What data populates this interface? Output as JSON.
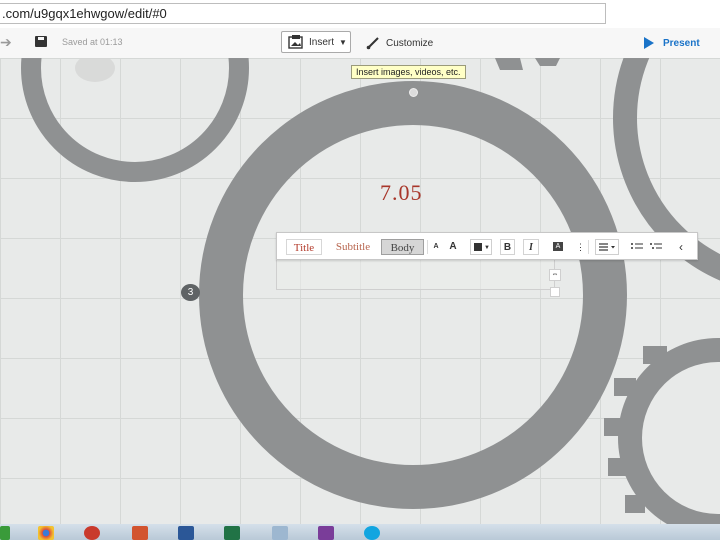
{
  "browser": {
    "url": ".com/u9gqx1ehwgow/edit/#0"
  },
  "toolbar": {
    "saved_label": "Saved at 01:13",
    "insert_label": "Insert",
    "customize_label": "Customize",
    "present_label": "Present",
    "icons": [
      "arrow-icon",
      "save-icon",
      "insert-icon",
      "chevron-down-icon",
      "brush-icon",
      "play-icon"
    ]
  },
  "tooltip": {
    "text": "Insert images, videos, etc."
  },
  "canvas": {
    "title": "7.05",
    "step_number": "3",
    "colors": {
      "title": "#a8362a",
      "gear": "#8f9192",
      "background": "#e8eae9"
    }
  },
  "format_bar": {
    "styles": [
      "Title",
      "Subtitle",
      "Body"
    ],
    "active_style": "Body",
    "font_small": "A",
    "font_large": "A",
    "bold": "B",
    "italic": "I",
    "highlight": "A",
    "more": "⋮",
    "collapse": "‹"
  },
  "taskbar": {
    "apps": [
      "windows-icon",
      "chrome-icon",
      "chrome-icon",
      "powerpoint-icon",
      "word-icon",
      "excel-icon",
      "file-icon",
      "onenote-icon",
      "skype-icon"
    ]
  }
}
